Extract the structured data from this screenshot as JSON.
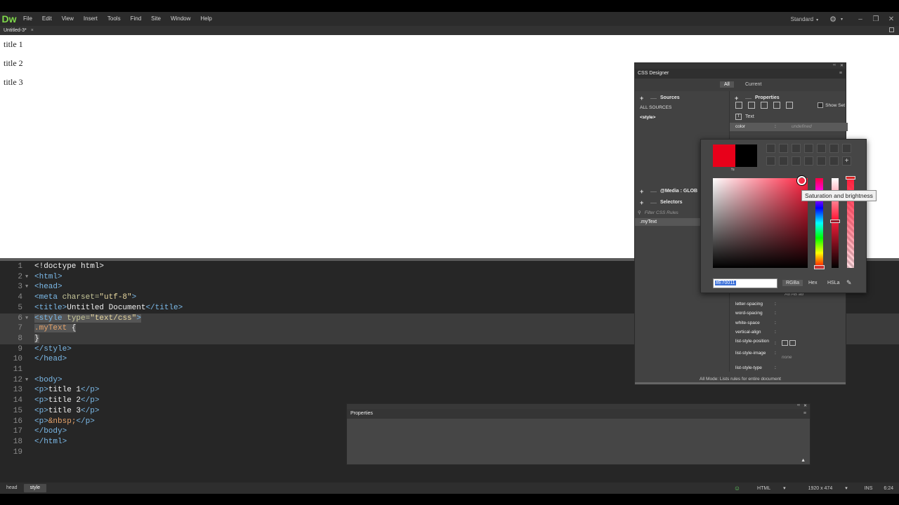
{
  "app": {
    "logo": "Dw",
    "menu": [
      "File",
      "Edit",
      "View",
      "Insert",
      "Tools",
      "Find",
      "Site",
      "Window",
      "Help"
    ],
    "workspace": "Standard",
    "workspace_caret": "▾",
    "gear_icon": "⚙",
    "gear_caret": "▾",
    "win_min": "–",
    "win_max": "❐",
    "win_close": "✕"
  },
  "tabs": {
    "doc_tab": "Untitled-3*",
    "close": "×"
  },
  "live_view": {
    "paragraphs": [
      "title 1",
      "title 2",
      "title 3"
    ]
  },
  "code": {
    "lines": [
      {
        "n": "1"
      },
      {
        "n": "2"
      },
      {
        "n": "3"
      },
      {
        "n": "4"
      },
      {
        "n": "5"
      },
      {
        "n": "6"
      },
      {
        "n": "7"
      },
      {
        "n": "8"
      },
      {
        "n": "9"
      },
      {
        "n": "10"
      },
      {
        "n": "11"
      },
      {
        "n": "12"
      },
      {
        "n": "13"
      },
      {
        "n": "14"
      },
      {
        "n": "15"
      },
      {
        "n": "16"
      },
      {
        "n": "17"
      },
      {
        "n": "18"
      },
      {
        "n": "19"
      }
    ],
    "doctype": "<!doctype html>",
    "html_open": "<html>",
    "head_open": "<head>",
    "meta_tag": "<meta ",
    "meta_attr": "charset=",
    "meta_val": "\"utf-8\"",
    "meta_close": ">",
    "title_open": "<title>",
    "title_text": "Untitled Document",
    "title_close": "</title>",
    "style_open": "<style ",
    "style_attr": "type=",
    "style_val": "\"text/css\"",
    "style_gt": ">",
    "selector": ".myText",
    "brace_open": " {",
    "brace_close": "}",
    "style_close": "</style>",
    "head_close": "</head>",
    "body_open": "<body>",
    "p_open": "<p>",
    "p_close": "</p>",
    "p1": "title 1",
    "p2": "title 2",
    "p3": "title 3",
    "nbsp": "&nbsp;",
    "body_close": "</body>",
    "html_close": "</html>"
  },
  "statusbar": {
    "tags": [
      "head",
      "style"
    ],
    "active_tag": "style",
    "ok_icon": "☺",
    "doc_type": "HTML",
    "doc_type_caret": "▾",
    "window_size": "1920 x 474",
    "size_caret": "▾",
    "ins": "INS",
    "cursor_pos": "6:24"
  },
  "css_designer": {
    "title": "CSS Designer",
    "menu_icon": "≡",
    "collapse_icon": "‹‹",
    "close_icon": "✕",
    "mode_all": "All",
    "mode_current": "Current",
    "active_mode": "All",
    "sources_label": "Sources",
    "plus": "+",
    "minus": "—",
    "all_sources": "ALL SOURCES",
    "style_source": "<style>",
    "media_label": "@Media : GLOB",
    "selectors_label": "Selectors",
    "filter_placeholder": "Filter CSS Rules",
    "filter_icon": "⚲",
    "selected_rule": ".myText",
    "properties_label": "Properties",
    "show_set": "Show Set",
    "text_category": "Text",
    "text_cat_icon": "T",
    "color_prop": "color",
    "color_value": "undefined",
    "colon": ":",
    "props": [
      {
        "name": "letter-spacing",
        "value": ""
      },
      {
        "name": "word-spacing",
        "value": ""
      },
      {
        "name": "white-space",
        "value": ""
      },
      {
        "name": "vertical-align",
        "value": ""
      },
      {
        "name": "list-style-position",
        "value": ""
      },
      {
        "name": "list-style-image",
        "value": "none"
      },
      {
        "name": "list-style-type",
        "value": ""
      }
    ],
    "partial_row": "Ab AB ab",
    "footer": "All Mode: Lists rules for entire document"
  },
  "color_picker": {
    "current_color": "#E8001A",
    "previous_color": "#000000",
    "swap_icon": "⇆",
    "add_swatch": "+",
    "tooltip": "Saturation and brightness",
    "hex_value": "#E70011",
    "formats": [
      "RGBa",
      "Hex",
      "HSLa"
    ],
    "eyedropper_icon": "✎"
  },
  "properties_panel": {
    "title": "Properties",
    "menu_icon": "≡",
    "collapse_icon": "‹‹",
    "close_icon": "✕",
    "expand_icon": "▲"
  }
}
